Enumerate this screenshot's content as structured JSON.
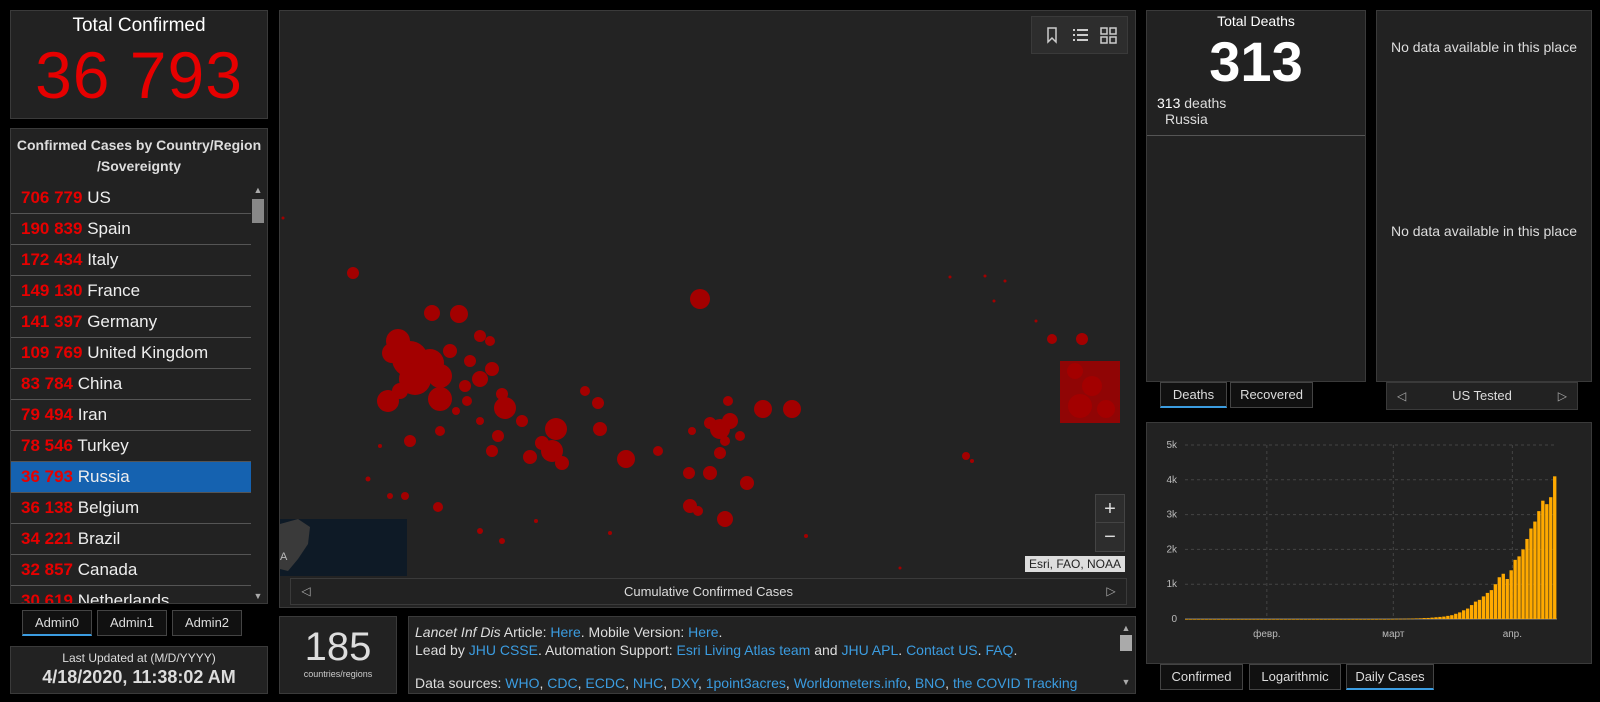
{
  "total_confirmed": {
    "title": "Total Confirmed",
    "value": "36 793"
  },
  "country_list": {
    "header": "Confirmed Cases by Country/Region/Sovereignty",
    "header_line1": "Confirmed Cases by Country/Region",
    "header_line2": "/Sovereignty",
    "rows": [
      {
        "count": "706 779",
        "name": "US",
        "selected": false
      },
      {
        "count": "190 839",
        "name": "Spain",
        "selected": false
      },
      {
        "count": "172 434",
        "name": "Italy",
        "selected": false
      },
      {
        "count": "149 130",
        "name": "France",
        "selected": false
      },
      {
        "count": "141 397",
        "name": "Germany",
        "selected": false
      },
      {
        "count": "109 769",
        "name": "United Kingdom",
        "selected": false
      },
      {
        "count": "83 784",
        "name": "China",
        "selected": false
      },
      {
        "count": "79 494",
        "name": "Iran",
        "selected": false
      },
      {
        "count": "78 546",
        "name": "Turkey",
        "selected": false
      },
      {
        "count": "36 793",
        "name": "Russia",
        "selected": true
      },
      {
        "count": "36 138",
        "name": "Belgium",
        "selected": false
      },
      {
        "count": "34 221",
        "name": "Brazil",
        "selected": false
      },
      {
        "count": "32 857",
        "name": "Canada",
        "selected": false
      },
      {
        "count": "30 619",
        "name": "Netherlands",
        "selected": false
      }
    ]
  },
  "admin_tabs": [
    "Admin0",
    "Admin1",
    "Admin2"
  ],
  "last_updated": {
    "label": "Last Updated at (M/D/YYYY)",
    "value": "4/18/2020, 11:38:02 AM"
  },
  "map": {
    "footer_label": "Cumulative Confirmed Cases",
    "attribution": "Esri, FAO, NOAA",
    "zoom_in": "+",
    "zoom_out": "−",
    "minimap_label": "A"
  },
  "countries_count": {
    "value": "185",
    "label": "countries/regions"
  },
  "info": {
    "line1_prefix": "Lancet Inf Dis",
    "line1_article": " Article: ",
    "line1_here1": "Here",
    "line1_mobile": ". Mobile Version: ",
    "line1_here2": "Here",
    "line1_end": ".",
    "line2_lead": "Lead by ",
    "line2_jhucsse": "JHU CSSE",
    "line2_auto": ". Automation Support: ",
    "line2_esri": "Esri Living Atlas team",
    "line2_and": " and ",
    "line2_jhuapl": "JHU APL",
    "line2_dot": ". ",
    "line2_contact": "Contact US",
    "line2_dot2": ". ",
    "line2_faq": "FAQ",
    "line2_end": ".",
    "line3_prefix": "Data sources: ",
    "sources": [
      "WHO",
      "CDC",
      "ECDC",
      "NHC",
      "DXY",
      "1point3acres",
      "Worldometers.info",
      "BNO",
      "the COVID Tracking"
    ]
  },
  "deaths": {
    "title": "Total Deaths",
    "value": "313",
    "detail_count": "313",
    "detail_unit": " deaths",
    "detail_place": "Russia",
    "tabs": [
      "Deaths",
      "Recovered"
    ]
  },
  "tested": {
    "message1": "No data available in this place",
    "message2": "No data available in this place",
    "footer_label": "US Tested"
  },
  "chart_tabs": [
    "Confirmed",
    "Logarithmic",
    "Daily Cases"
  ],
  "colors": {
    "confirmed": "#e60000",
    "selected_row": "#1562b0",
    "link": "#3b9ce0",
    "bars": "#ffaa00",
    "map_dots": "#a30000"
  },
  "chart_data": {
    "type": "bar",
    "title": "",
    "xlabel": "",
    "ylabel": "",
    "x_ticks": [
      "февр.",
      "март",
      "апр."
    ],
    "y_ticks": [
      "0",
      "1k",
      "2k",
      "3k",
      "4k",
      "5k"
    ],
    "ylim": [
      0,
      5000
    ],
    "grid": true,
    "series": [
      {
        "values": [
          0,
          0,
          0,
          0,
          0,
          0,
          0,
          0,
          0,
          0,
          0,
          0,
          0,
          0,
          0,
          0,
          0,
          0,
          0,
          0,
          0,
          0,
          0,
          0,
          0,
          0,
          0,
          0,
          0,
          0,
          0,
          0,
          0,
          0,
          0,
          0,
          0,
          0,
          0,
          0,
          0,
          0,
          0,
          0,
          0,
          0,
          0,
          0,
          0,
          1,
          0,
          1,
          2,
          5,
          6,
          8,
          11,
          13,
          17,
          20,
          28,
          30,
          40,
          50,
          60,
          70,
          90,
          110,
          150,
          190,
          250,
          300,
          400,
          500,
          550,
          650,
          750,
          830,
          1000,
          1200,
          1300,
          1150,
          1400,
          1700,
          1800,
          2000,
          2300,
          2600,
          2800,
          3100,
          3400,
          3300,
          3500,
          4100
        ]
      }
    ]
  }
}
